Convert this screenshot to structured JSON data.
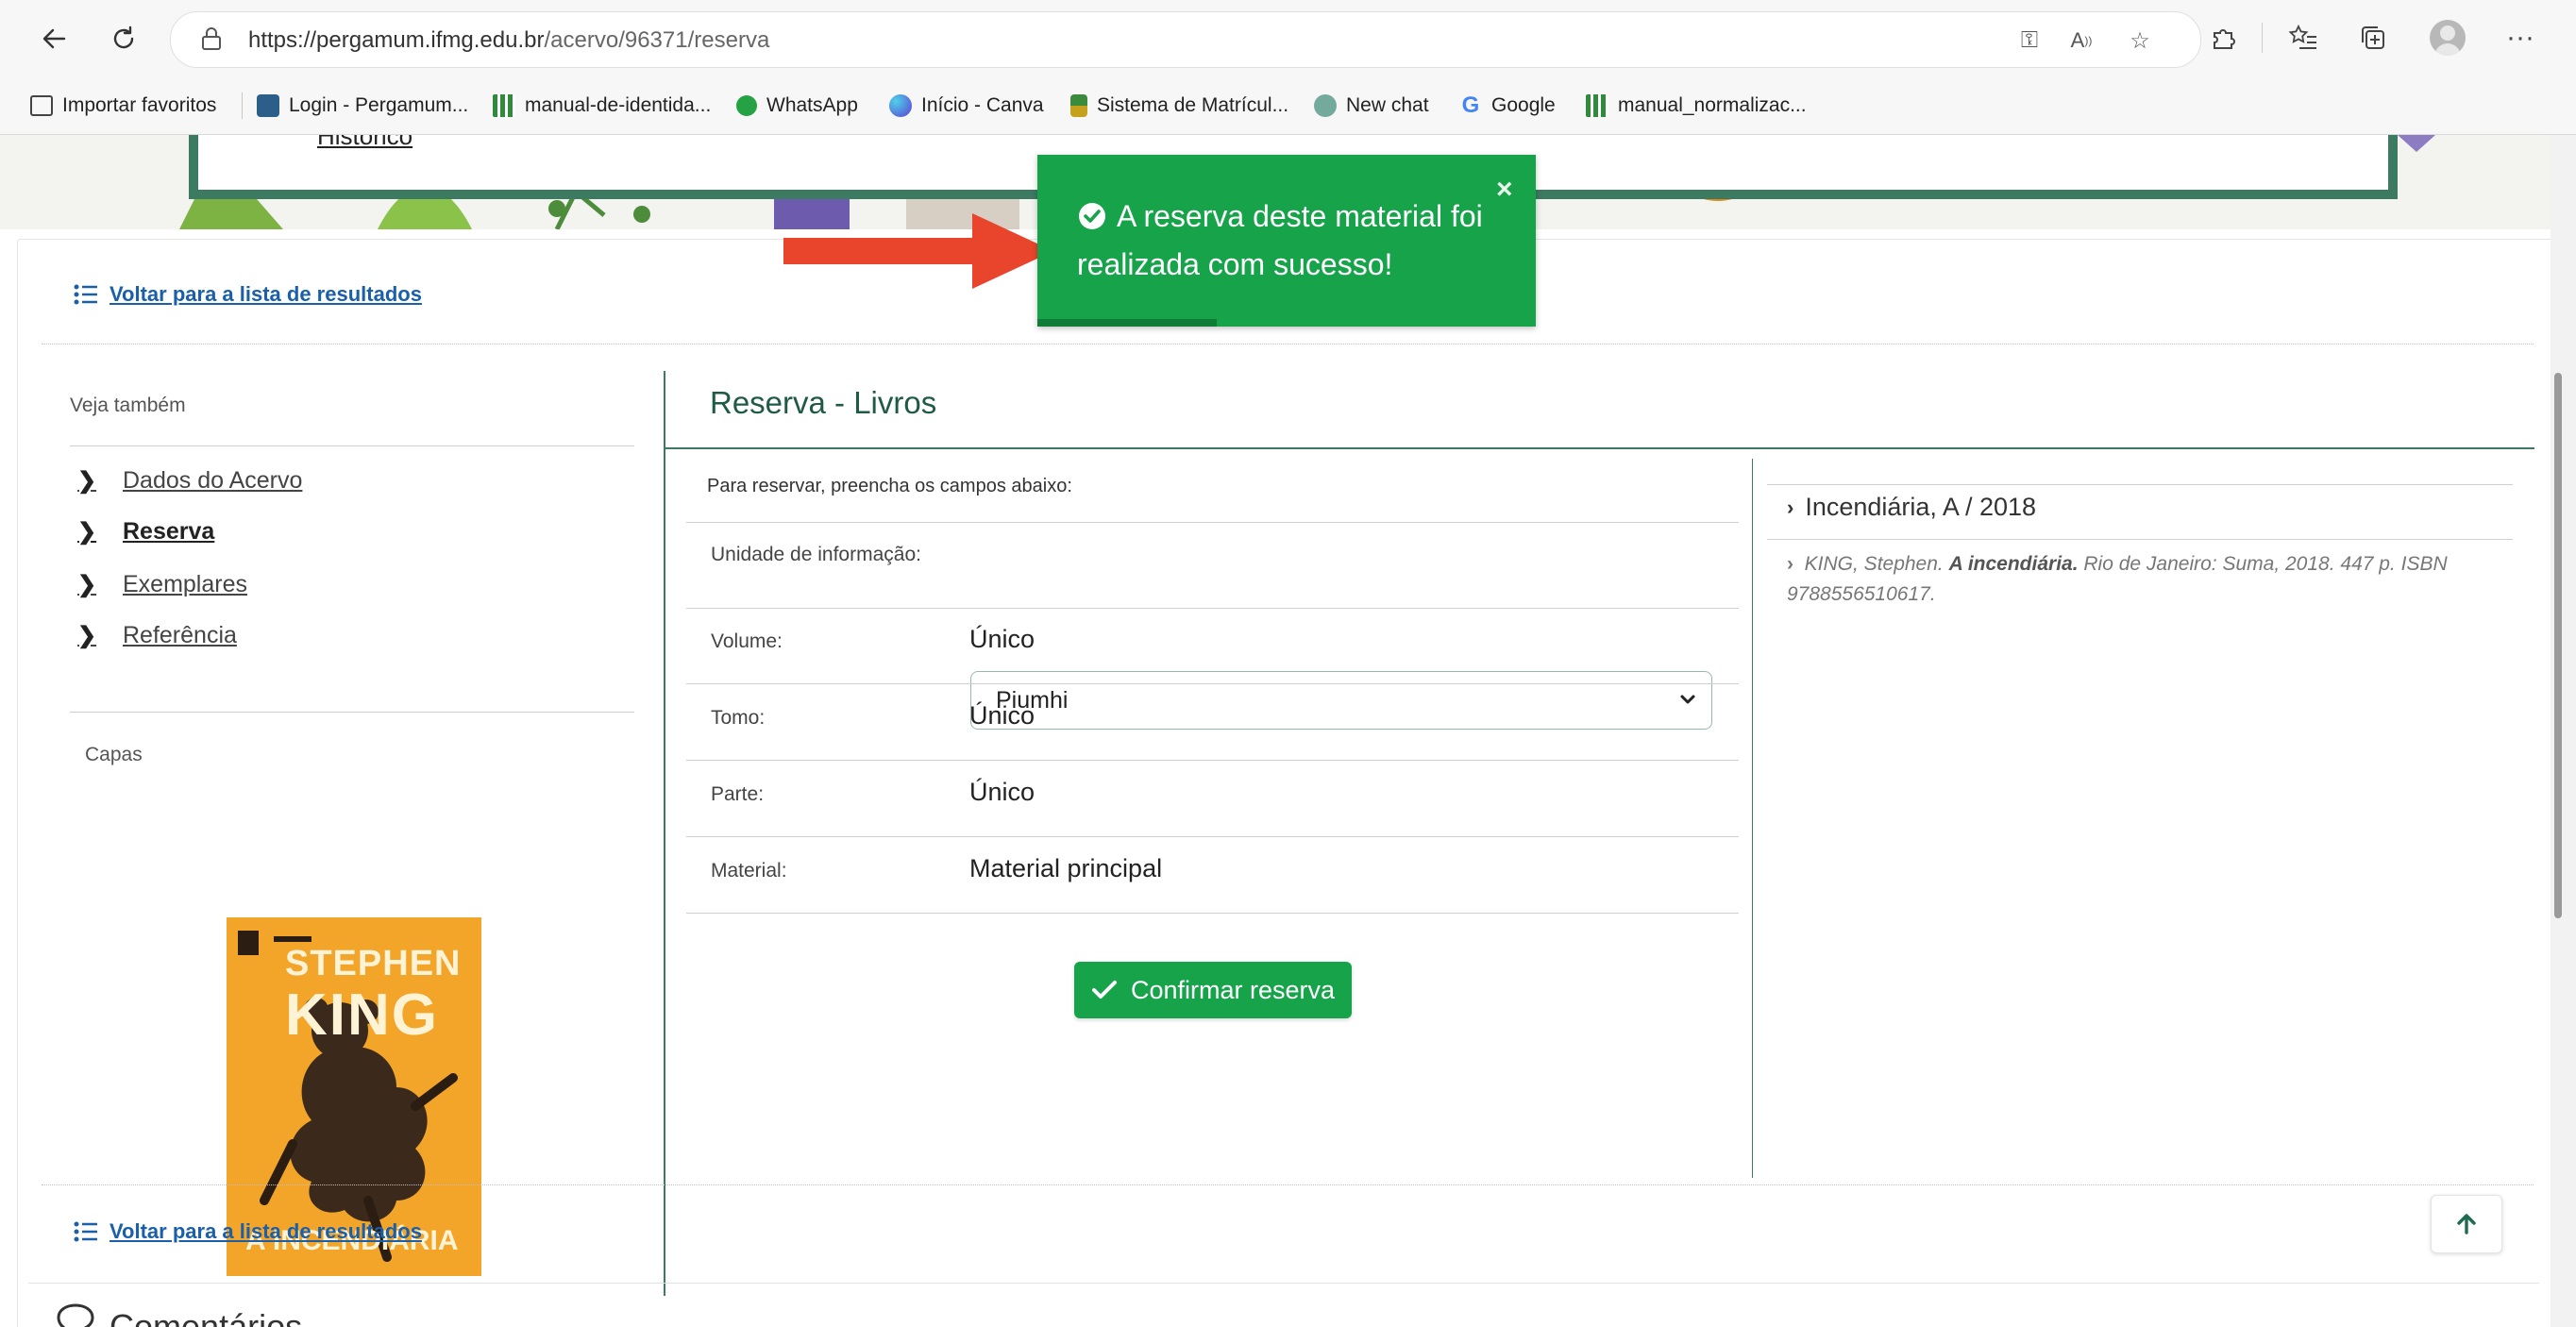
{
  "browser": {
    "url_host": "https://pergamum.ifmg.edu.br",
    "url_path": "/acervo/96371/reserva",
    "icons": {
      "back": "arrow-left-icon",
      "refresh": "refresh-icon",
      "lock": "lock-icon",
      "key": "key-icon",
      "read_aloud": "read-aloud-icon",
      "add_favorite": "star-add-icon",
      "extensions": "puzzle-icon",
      "favorites": "favorites-list-icon",
      "collections": "collections-icon",
      "profile": "profile-avatar-icon",
      "more": "more-dots-icon"
    }
  },
  "favorites_bar": {
    "items": [
      {
        "label": "Importar favoritos",
        "icon": "import-icon"
      },
      {
        "label": "Login - Pergamum...",
        "icon": "pergamum-icon"
      },
      {
        "label": "manual-de-identida...",
        "icon": "ifmg-icon"
      },
      {
        "label": "WhatsApp",
        "icon": "whatsapp-icon"
      },
      {
        "label": "Início - Canva",
        "icon": "canva-icon"
      },
      {
        "label": "Sistema de Matrícul...",
        "icon": "sistema-icon"
      },
      {
        "label": "New chat",
        "icon": "chatgpt-icon"
      },
      {
        "label": "Google",
        "icon": "google-icon"
      },
      {
        "label": "manual_normalizac...",
        "icon": "ifmg-icon"
      }
    ]
  },
  "banner": {
    "link_partial": "Histórico"
  },
  "toast": {
    "message": "A reserva deste material foi realizada com sucesso!",
    "close": "×"
  },
  "page": {
    "back_link": "Voltar para a lista de resultados",
    "sidebar": {
      "heading": "Veja também",
      "items": [
        {
          "label": "Dados do Acervo",
          "active": false
        },
        {
          "label": "Reserva",
          "active": true
        },
        {
          "label": "Exemplares",
          "active": false
        },
        {
          "label": "Referência",
          "active": false
        }
      ],
      "covers_heading": "Capas",
      "cover": {
        "author": "STEPHEN KING",
        "author_first": "STEPHEN",
        "author_last": "KING",
        "title": "A INCENDIÁRIA"
      }
    },
    "reserve": {
      "title": "Reserva - Livros",
      "intro": "Para reservar, preencha os campos abaixo:",
      "fields": {
        "unidade_label": "Unidade de informação:",
        "unidade_value": "Piumhi",
        "volume_label": "Volume:",
        "volume_value": "Único",
        "tomo_label": "Tomo:",
        "tomo_value": "Único",
        "parte_label": "Parte:",
        "parte_value": "Único",
        "material_label": "Material:",
        "material_value": "Material principal"
      },
      "confirm_button": "Confirmar reserva"
    },
    "record": {
      "title": "Incendiária, A / 2018",
      "ref_author": "KING, Stephen.",
      "ref_title": "A incendiária.",
      "ref_rest": "Rio de Janeiro: Suma, 2018. 447 p. ISBN 9788556510617."
    },
    "comments_heading": "Comentários"
  },
  "colors": {
    "brand_green": "#3d7a62",
    "success_green": "#16a34a",
    "link_blue": "#1a5fa8",
    "annotation_arrow": "#e8452c"
  }
}
